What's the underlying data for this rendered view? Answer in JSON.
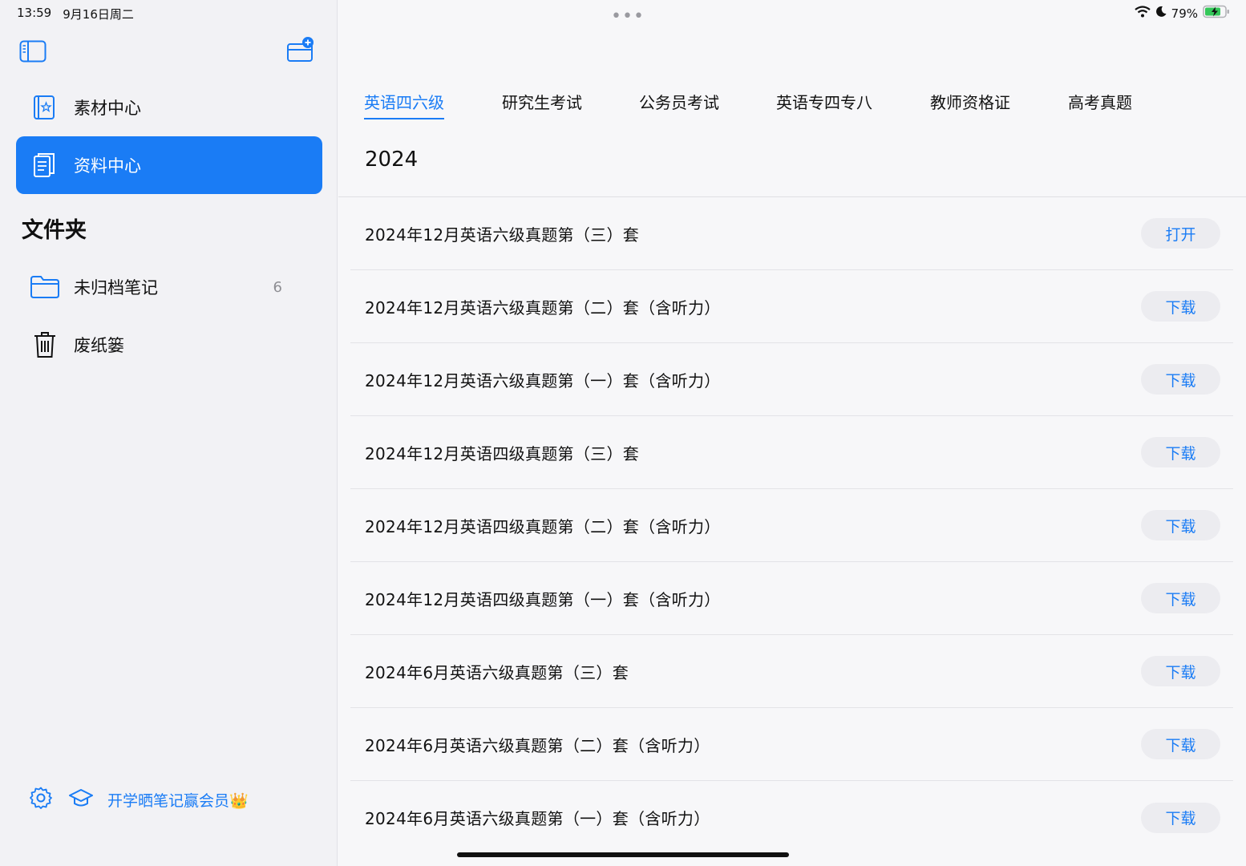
{
  "status": {
    "time": "13:59",
    "date": "9月16日周二",
    "battery": "79%",
    "colors": {
      "accent": "#1a7cf5",
      "battery_fill": "#34c759"
    }
  },
  "sidebar": {
    "nav": [
      {
        "label": "素材中心",
        "icon": "starred-notebook-icon"
      },
      {
        "label": "资料中心",
        "icon": "document-icon"
      }
    ],
    "section_title": "文件夹",
    "folders": [
      {
        "label": "未归档笔记",
        "count": "6",
        "icon": "folder-icon"
      },
      {
        "label": "废纸篓",
        "count": "",
        "icon": "trash-icon"
      }
    ],
    "promo": "开学晒笔记赢会员👑"
  },
  "main": {
    "tabs": [
      "英语四六级",
      "研究生考试",
      "公务员考试",
      "英语专四专八",
      "教师资格证",
      "高考真题"
    ],
    "active_tab": "英语四六级",
    "year": "2024",
    "items": [
      {
        "title": "2024年12月英语六级真题第（三）套",
        "action": "打开"
      },
      {
        "title": "2024年12月英语六级真题第（二）套（含听力）",
        "action": "下载"
      },
      {
        "title": "2024年12月英语六级真题第（一）套（含听力）",
        "action": "下载"
      },
      {
        "title": "2024年12月英语四级真题第（三）套",
        "action": "下载"
      },
      {
        "title": "2024年12月英语四级真题第（二）套（含听力）",
        "action": "下载"
      },
      {
        "title": "2024年12月英语四级真题第（一）套（含听力）",
        "action": "下载"
      },
      {
        "title": "2024年6月英语六级真题第（三）套",
        "action": "下载"
      },
      {
        "title": "2024年6月英语六级真题第（二）套（含听力）",
        "action": "下载"
      },
      {
        "title": "2024年6月英语六级真题第（一）套（含听力）",
        "action": "下载"
      }
    ]
  }
}
